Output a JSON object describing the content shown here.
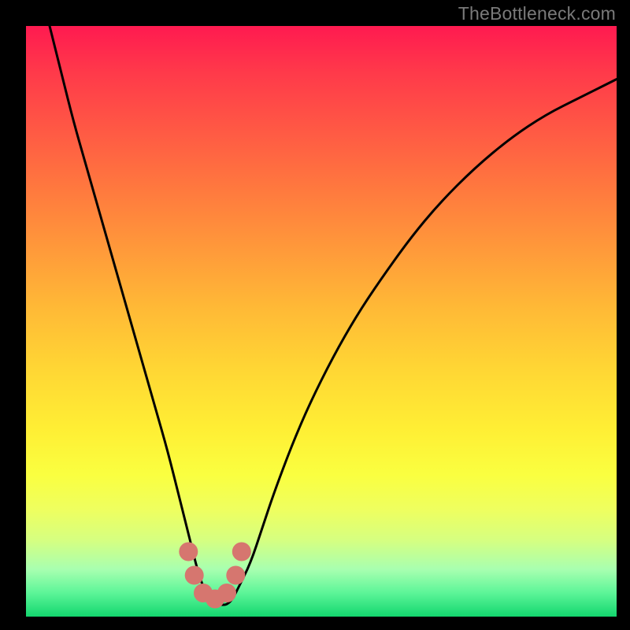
{
  "watermark": "TheBottleneck.com",
  "colors": {
    "curve_stroke": "#000000",
    "marker_fill": "#d6766f",
    "frame": "#000000"
  },
  "chart_data": {
    "type": "line",
    "title": "",
    "xlabel": "",
    "ylabel": "",
    "xlim": [
      0,
      100
    ],
    "ylim": [
      0,
      100
    ],
    "grid": false,
    "legend": false,
    "series": [
      {
        "name": "bottleneck-curve",
        "x": [
          4,
          6,
          8,
          10,
          12,
          14,
          16,
          18,
          20,
          22,
          24,
          26,
          27,
          28,
          29,
          30,
          31,
          32,
          33,
          34,
          35,
          36,
          38,
          40,
          42,
          45,
          48,
          52,
          56,
          60,
          65,
          70,
          76,
          82,
          88,
          94,
          100
        ],
        "values": [
          100,
          92,
          84,
          77,
          70,
          63,
          56,
          49,
          42,
          35,
          28,
          20,
          16,
          12,
          8,
          5,
          3,
          2,
          2,
          2,
          3,
          5,
          9,
          15,
          21,
          29,
          36,
          44,
          51,
          57,
          64,
          70,
          76,
          81,
          85,
          88,
          91
        ]
      }
    ],
    "markers": [
      {
        "x": 27.5,
        "y": 11
      },
      {
        "x": 28.5,
        "y": 7
      },
      {
        "x": 30.0,
        "y": 4
      },
      {
        "x": 32.0,
        "y": 3
      },
      {
        "x": 34.0,
        "y": 4
      },
      {
        "x": 35.5,
        "y": 7
      },
      {
        "x": 36.5,
        "y": 11
      }
    ]
  }
}
